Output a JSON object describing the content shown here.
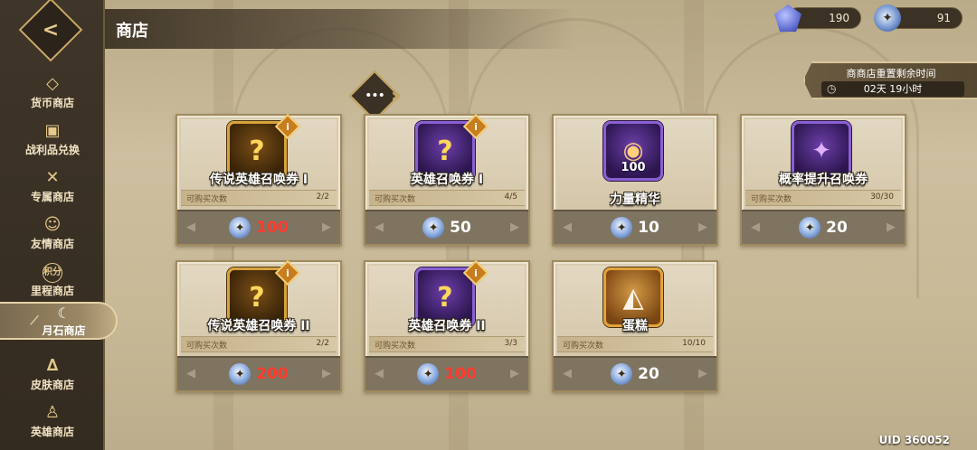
{
  "header": {
    "title": "商店"
  },
  "currencies": [
    {
      "icon": "diamond-icon",
      "value": "190"
    },
    {
      "icon": "moonstone-icon",
      "value": "91"
    }
  ],
  "sidebar": {
    "back_icon": "<",
    "items": [
      {
        "label": "货币商店",
        "icon": "diamond-icon",
        "glyph": "◇"
      },
      {
        "label": "战利品兑换",
        "icon": "treasure-chest-icon",
        "glyph": "▣"
      },
      {
        "label": "专属商店",
        "icon": "crossed-swords-icon",
        "glyph": "✕"
      },
      {
        "label": "友情商店",
        "icon": "friendship-icon",
        "glyph": "☺"
      },
      {
        "label": "里程商店",
        "icon": "points-icon",
        "glyph": "积分"
      },
      {
        "label": "月石商店",
        "icon": "moon-icon",
        "glyph": "☾",
        "active": true
      },
      {
        "label": "皮肤商店",
        "icon": "hanger-icon",
        "glyph": "∆"
      },
      {
        "label": "英雄商店",
        "icon": "hero-icon",
        "glyph": "♙"
      }
    ]
  },
  "refresh": {
    "title": "商商店重置剩余时间",
    "time": "02天 19小时"
  },
  "items": [
    {
      "name": "传说英雄召唤券 I",
      "limit_label": "可购买次数",
      "limit": "2/2",
      "price": "100",
      "price_red": true,
      "frame": "gold",
      "glyph": "?",
      "qty": "",
      "info": true
    },
    {
      "name": "英雄召唤券 I",
      "limit_label": "可购买次数",
      "limit": "4/5",
      "price": "50",
      "price_red": false,
      "frame": "purple",
      "glyph": "?",
      "qty": "",
      "info": true
    },
    {
      "name": "力量精华",
      "limit_label": "",
      "limit": "",
      "price": "10",
      "price_red": false,
      "frame": "purple",
      "glyph": "◉",
      "qty": "100",
      "info": false
    },
    {
      "name": "概率提升召唤券",
      "limit_label": "可购买次数",
      "limit": "30/30",
      "price": "20",
      "price_red": false,
      "frame": "purple",
      "glyph": "✦",
      "qty": "",
      "info": false
    },
    {
      "name": "传说英雄召唤券 II",
      "limit_label": "可购买次数",
      "limit": "2/2",
      "price": "200",
      "price_red": true,
      "frame": "gold",
      "glyph": "?",
      "qty": "",
      "info": true
    },
    {
      "name": "英雄召唤券 II",
      "limit_label": "可购买次数",
      "limit": "3/3",
      "price": "100",
      "price_red": true,
      "frame": "purple",
      "glyph": "?",
      "qty": "",
      "info": true
    },
    {
      "name": "蛋糕",
      "limit_label": "可购买次数",
      "limit": "10/10",
      "price": "20",
      "price_red": false,
      "frame": "orange",
      "glyph": "◭",
      "qty": "",
      "info": false
    }
  ],
  "uid": "UID 360052"
}
